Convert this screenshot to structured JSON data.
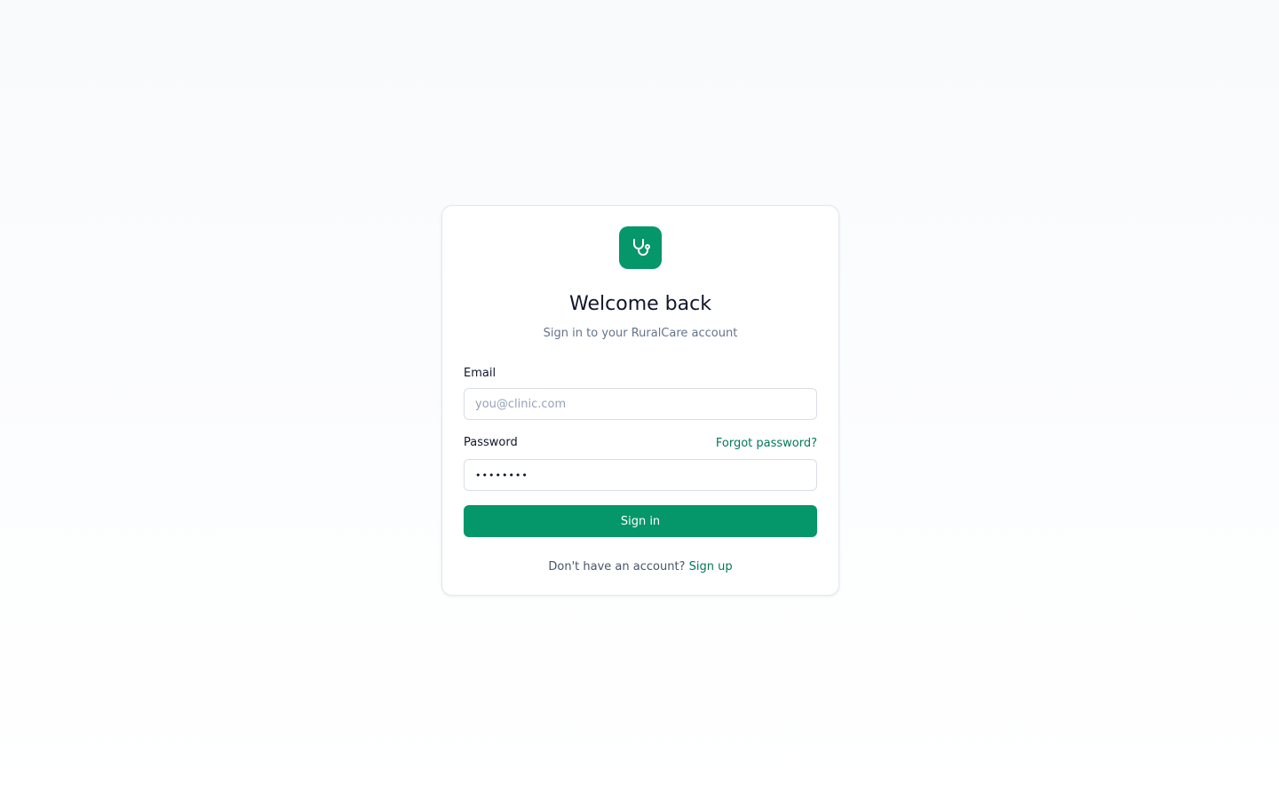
{
  "brand": {
    "logo_icon": "stethoscope-icon",
    "accent_color": "#059669",
    "link_color": "#047857"
  },
  "header": {
    "title": "Welcome back",
    "subtitle": "Sign in to your RuralCare account"
  },
  "form": {
    "email": {
      "label": "Email",
      "placeholder": "you@clinic.com",
      "value": ""
    },
    "password": {
      "label": "Password",
      "value": "••••••••",
      "forgot_link": "Forgot password?"
    },
    "submit_label": "Sign in"
  },
  "footer": {
    "prompt": "Don't have an account?",
    "signup_link": "Sign up"
  }
}
